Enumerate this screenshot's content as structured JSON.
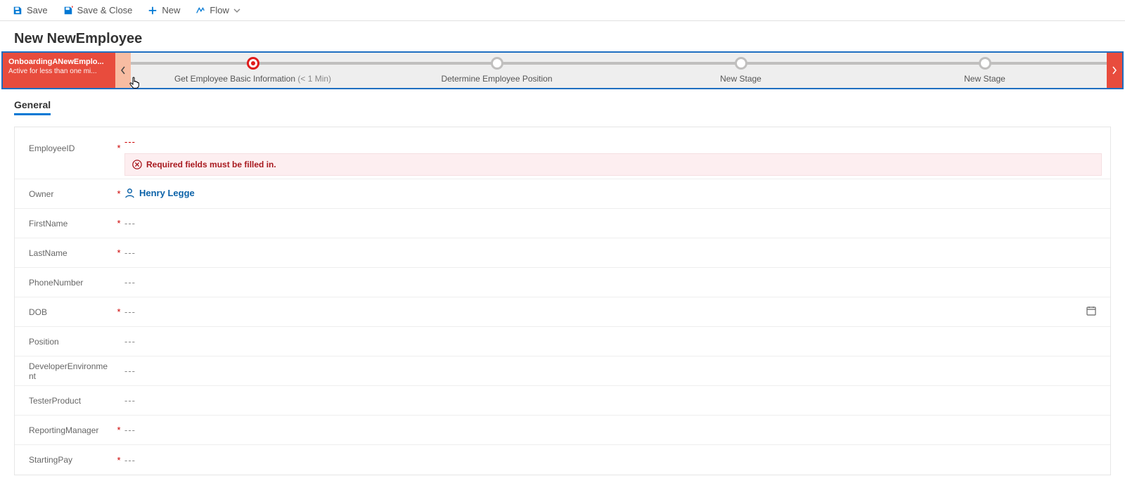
{
  "commandbar": {
    "save": "Save",
    "saveclose": "Save & Close",
    "new": "New",
    "flow": "Flow"
  },
  "record_title": "New NewEmployee",
  "bpf": {
    "name": "OnboardingANewEmplo...",
    "status": "Active for less than one mi...",
    "stages": [
      {
        "label": "Get Employee Basic Information",
        "suffix": "(< 1 Min)"
      },
      {
        "label": "Determine Employee Position",
        "suffix": ""
      },
      {
        "label": "New Stage",
        "suffix": ""
      },
      {
        "label": "New Stage",
        "suffix": ""
      }
    ]
  },
  "tab": {
    "general": "General"
  },
  "err": {
    "message": "Required fields must be filled in."
  },
  "owner": "Henry Legge",
  "fields": {
    "employeeid_label": "EmployeeID",
    "employeeid_value": "---",
    "owner_label": "Owner",
    "firstname_label": "FirstName",
    "firstname_value": "---",
    "lastname_label": "LastName",
    "lastname_value": "---",
    "phonenumber_label": "PhoneNumber",
    "phonenumber_value": "---",
    "dob_label": "DOB",
    "dob_value": "---",
    "position_label": "Position",
    "position_value": "---",
    "devenv_label": "DeveloperEnvironment",
    "devenv_value": "---",
    "testerproduct_label": "TesterProduct",
    "testerproduct_value": "---",
    "reportingmanager_label": "ReportingManager",
    "reportingmanager_value": "---",
    "startingpay_label": "StartingPay",
    "startingpay_value": "---"
  }
}
